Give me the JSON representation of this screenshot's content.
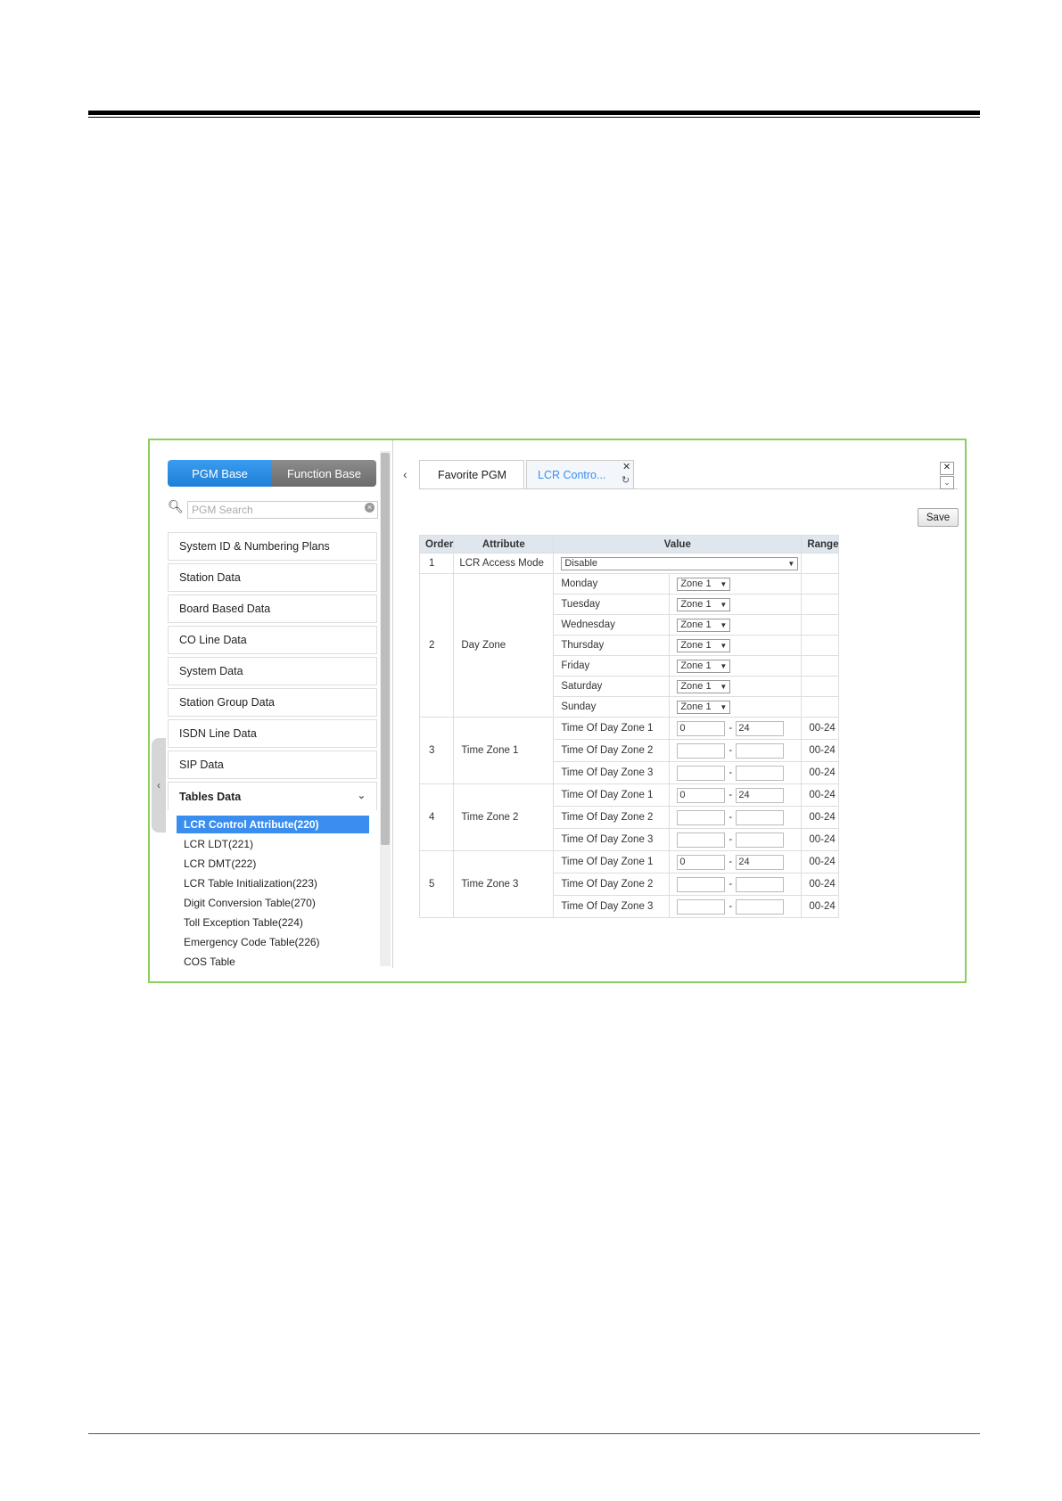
{
  "sidebar": {
    "toggle": {
      "pgm_base": "PGM Base",
      "function_base": "Function Base"
    },
    "search_placeholder": "PGM Search",
    "menu": [
      "System ID & Numbering Plans",
      "Station Data",
      "Board Based Data",
      "CO Line Data",
      "System Data",
      "Station Group Data",
      "ISDN Line Data",
      "SIP Data",
      "Tables Data"
    ],
    "sub_items": [
      "LCR Control Attribute(220)",
      "LCR LDT(221)",
      "LCR DMT(222)",
      "LCR Table Initialization(223)",
      "Digit Conversion Table(270)",
      "Toll Exception Table(224)",
      "Emergency Code Table(226)",
      "COS Table"
    ]
  },
  "tabs": {
    "favorite": "Favorite PGM",
    "lcr": "LCR Contro..."
  },
  "save_label": "Save",
  "table": {
    "headers": {
      "order": "Order",
      "attribute": "Attribute",
      "value": "Value",
      "range": "Range"
    },
    "access_mode": {
      "order": "1",
      "label": "LCR Access Mode",
      "value": "Disable"
    },
    "day_zone": {
      "order": "2",
      "label": "Day Zone",
      "days": [
        {
          "day": "Monday",
          "zone": "Zone 1"
        },
        {
          "day": "Tuesday",
          "zone": "Zone 1"
        },
        {
          "day": "Wednesday",
          "zone": "Zone 1"
        },
        {
          "day": "Thursday",
          "zone": "Zone 1"
        },
        {
          "day": "Friday",
          "zone": "Zone 1"
        },
        {
          "day": "Saturday",
          "zone": "Zone 1"
        },
        {
          "day": "Sunday",
          "zone": "Zone 1"
        }
      ]
    },
    "time_zones": [
      {
        "order": "3",
        "label": "Time Zone 1",
        "rows": [
          {
            "name": "Time Of Day Zone 1",
            "from": "0",
            "to": "24",
            "range": "00-24"
          },
          {
            "name": "Time Of Day Zone 2",
            "from": "",
            "to": "",
            "range": "00-24"
          },
          {
            "name": "Time Of Day Zone 3",
            "from": "",
            "to": "",
            "range": "00-24"
          }
        ]
      },
      {
        "order": "4",
        "label": "Time Zone 2",
        "rows": [
          {
            "name": "Time Of Day Zone 1",
            "from": "0",
            "to": "24",
            "range": "00-24"
          },
          {
            "name": "Time Of Day Zone 2",
            "from": "",
            "to": "",
            "range": "00-24"
          },
          {
            "name": "Time Of Day Zone 3",
            "from": "",
            "to": "",
            "range": "00-24"
          }
        ]
      },
      {
        "order": "5",
        "label": "Time Zone 3",
        "rows": [
          {
            "name": "Time Of Day Zone 1",
            "from": "0",
            "to": "24",
            "range": "00-24"
          },
          {
            "name": "Time Of Day Zone 2",
            "from": "",
            "to": "",
            "range": "00-24"
          },
          {
            "name": "Time Of Day Zone 3",
            "from": "",
            "to": "",
            "range": "00-24"
          }
        ]
      }
    ]
  }
}
